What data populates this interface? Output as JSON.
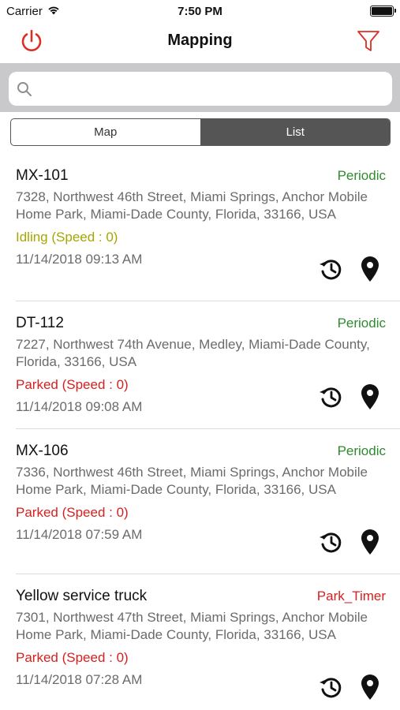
{
  "status_bar": {
    "carrier": "Carrier",
    "time": "7:50 PM"
  },
  "nav": {
    "title": "Mapping",
    "left_icon": "power-icon",
    "right_icon": "filter-icon",
    "accent_color": "#d93025"
  },
  "search": {
    "placeholder": "",
    "value": ""
  },
  "segments": {
    "map_label": "Map",
    "list_label": "List",
    "selected": "List"
  },
  "vehicles": [
    {
      "name": "MX-101",
      "type": "Periodic",
      "type_color": "#2e8b2e",
      "address": "7328, Northwest 46th Street, Miami Springs, Anchor Mobile Home Park, Miami-Dade County, Florida, 33166, USA",
      "status": "Idling (Speed : 0)",
      "status_color": "#a6a600",
      "timestamp": "11/14/2018 09:13 AM"
    },
    {
      "name": "DT-112",
      "type": "Periodic",
      "type_color": "#2e8b2e",
      "address": "7227, Northwest 74th Avenue, Medley, Miami-Dade County, Florida, 33166, USA",
      "status": "Parked (Speed : 0)",
      "status_color": "#d62020",
      "timestamp": "11/14/2018 09:08 AM"
    },
    {
      "name": "MX-106",
      "type": "Periodic",
      "type_color": "#2e8b2e",
      "address": "7336, Northwest 46th Street, Miami Springs, Anchor Mobile Home Park, Miami-Dade County, Florida, 33166, USA",
      "status": "Parked (Speed : 0)",
      "status_color": "#d62020",
      "timestamp": "11/14/2018 07:59 AM"
    },
    {
      "name": "Yellow service truck",
      "type": "Park_Timer",
      "type_color": "#d62020",
      "address": "7301, Northwest 47th Street, Miami Springs, Anchor Mobile Home Park, Miami-Dade County, Florida, 33166, USA",
      "status": "Parked (Speed : 0)",
      "status_color": "#d62020",
      "timestamp": "11/14/2018 07:28 AM"
    }
  ]
}
